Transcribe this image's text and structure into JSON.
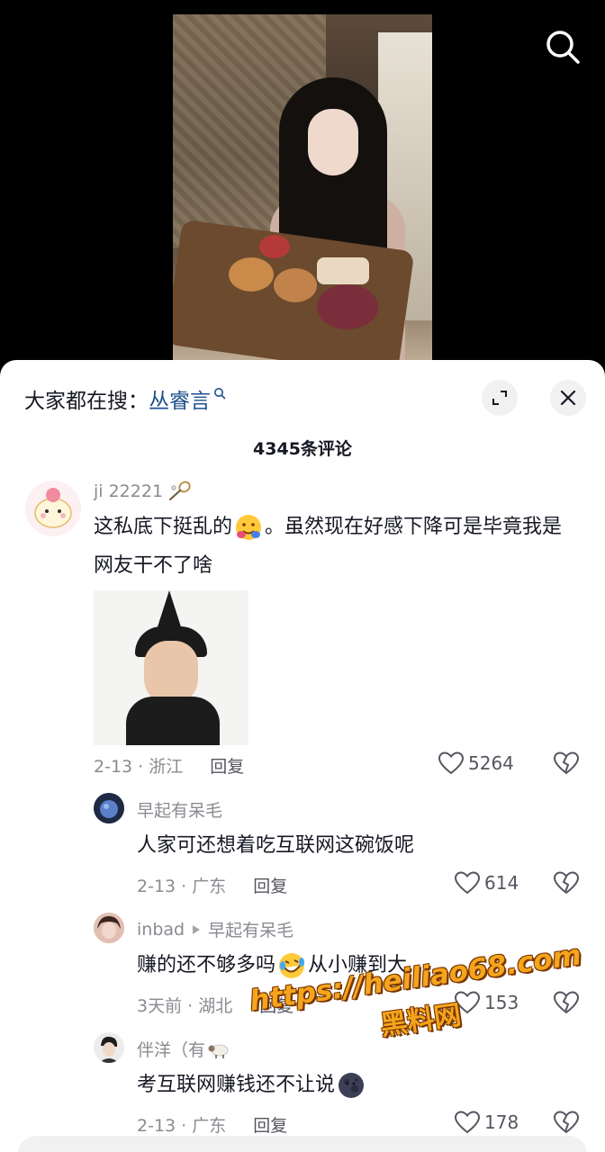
{
  "search_icon": "search-icon",
  "hot_search": {
    "label": "大家都在搜：",
    "keyword": "丛睿言"
  },
  "comment_count": "4345条评论",
  "comments": [
    {
      "user": "ji 22221",
      "user_badge_icon": "badminton-racket-icon",
      "text_1": "这私底下挺乱的",
      "text_2": "。虽然现在好感下降可是毕竟我是网友干不了啥",
      "emoji": "hugging-face-emoji",
      "date_location": "2-13 · 浙江",
      "reply_label": "回复",
      "likes": "5264"
    },
    {
      "user": "早起有呆毛",
      "text": "人家可还想着吃互联网这碗饭呢",
      "date_location": "2-13 · 广东",
      "reply_label": "回复",
      "likes": "614"
    },
    {
      "user": "inbad",
      "reply_to": "早起有呆毛",
      "text_1": "赚的还不够多吗",
      "text_2": "从小赚到大",
      "emoji": "rolling-on-floor-laughing-emoji",
      "date_location": "3天前 · 湖北",
      "reply_label": "回复",
      "likes": "153"
    },
    {
      "user": "伴洋（有",
      "text": "考互联网赚钱还不让说",
      "emoji": "dark-moon-face-emoji",
      "date_location": "2-13 · 广东",
      "reply_label": "回复",
      "likes": "178"
    }
  ],
  "watermark": {
    "url": "https://heiliao68.com",
    "brand": "黑料网"
  },
  "colors": {
    "keyword_blue": "#1f4f8f",
    "meta_gray": "#8a8b91",
    "watermark_orange": "#f4a51c"
  }
}
